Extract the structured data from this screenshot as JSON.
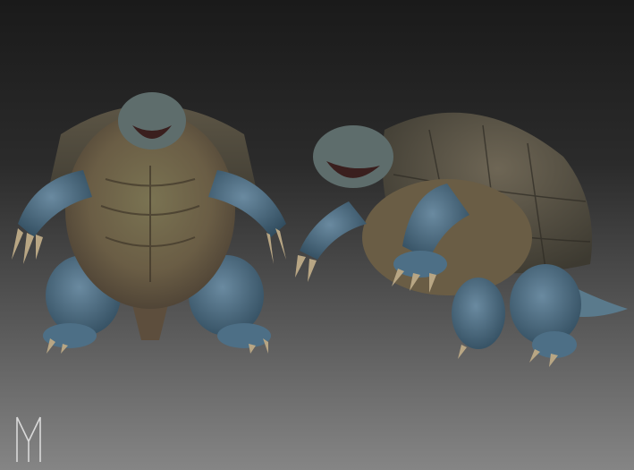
{
  "scene": {
    "subject": "turtle-creature-sculpt",
    "views": [
      "front-view",
      "side-view"
    ],
    "colors": {
      "background_top": "#1a1a1a",
      "background_bottom": "#858585",
      "skin_blue": "#4d6f86",
      "skin_blue_dark": "#2f4a5c",
      "belly": "#6f6a4f",
      "belly_warm": "#7b5e44",
      "shell": "#5c5545",
      "shell_dark": "#3d3a31",
      "claw": "#b8a684",
      "mouth": "#3a1f1e"
    }
  },
  "watermark": {
    "type": "logo",
    "glyph": "M",
    "color": "#d9d9d9"
  }
}
